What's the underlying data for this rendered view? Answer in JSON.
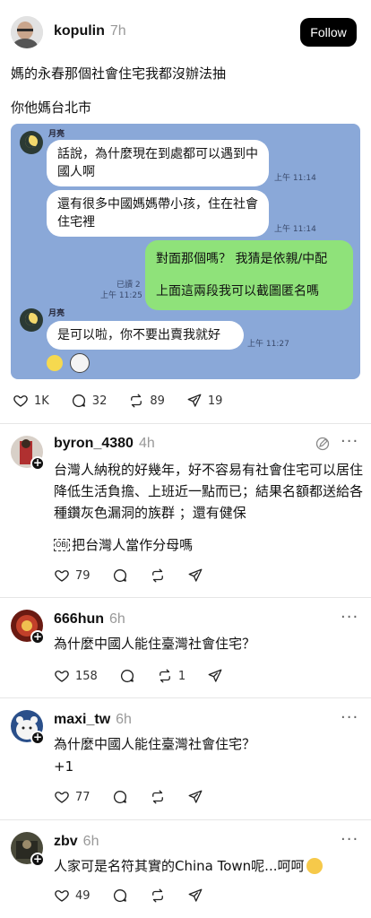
{
  "op": {
    "username": "kopulin",
    "time": "7h",
    "follow_label": "Follow",
    "line1": "媽的永春那個社會住宅我都沒辦法抽",
    "line2": "你他媽台北市",
    "chat": {
      "sender": "月亮",
      "msg1": "話說，為什麼現在到處都可以遇到中國人啊",
      "time1": "上午 11:14",
      "msg2": "還有很多中國媽媽帶小孩，住在社會住宅裡",
      "time2": "上午 11:14",
      "msg3a": "對面那個嗎？ 我猜是依親/中配",
      "msg3b": "上面這兩段我可以截圖匿名嗎",
      "read": "已讀 2",
      "time3": "上午 11:25",
      "msg4": "是可以啦，你不要出賣我就好",
      "time4": "上午 11:27"
    },
    "likes": "1K",
    "comments": "32",
    "reposts": "89",
    "shares": "19"
  },
  "replies": [
    {
      "username": "byron_4380",
      "time": "4h",
      "text": "台灣人納稅的好幾年，好不容易有社會住宅可以居住降低生活負擔、上班近一點而已；結果名額都送給各種鑽灰色漏洞的族群 ；還有健保",
      "text2": "把台灣人當作分母嗎",
      "obj": "OBJ",
      "likes": "79"
    },
    {
      "username": "666hun",
      "time": "6h",
      "text": "為什麼中國人能住臺灣社會住宅？",
      "likes": "158",
      "reposts": "1"
    },
    {
      "username": "maxi_tw",
      "time": "6h",
      "text": "為什麼中國人能住臺灣社會住宅？",
      "text2": "+1",
      "likes": "77"
    },
    {
      "username": "zbv",
      "time": "6h",
      "text": "人家可是名符其實的China Town呢...呵呵",
      "likes": "49"
    }
  ],
  "colors": {
    "chat_bg": "#8aa8d8",
    "green_bubble": "#8fe27a",
    "follow_bg": "#000000"
  }
}
